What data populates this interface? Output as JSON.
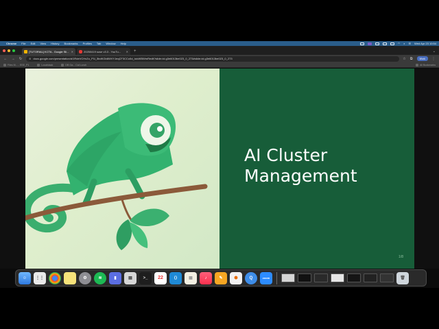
{
  "menubar": {
    "app_name": "Chrome",
    "items": [
      "File",
      "Edit",
      "View",
      "History",
      "Bookmarks",
      "Profiles",
      "Tab",
      "Window",
      "Help"
    ],
    "clock": "Wed Apr 23 10:54"
  },
  "tabs": [
    {
      "title": "[TUTORIAL] KCTA - Google Sli...",
      "favicon_color": "#f4b400",
      "active": true
    },
    {
      "title": "20250419 suse v3.3 - YouTu...",
      "favicon_color": "#e53935",
      "active": false
    }
  ],
  "address_bar": {
    "url": "docs.google.com/presentation/d/1RdeVCHvZo_P1l_5bdKGb8WVYJeqCF3CCo5d_lcicWBWmRedit?slide=id.g3e6013be023_0_273#slide=id.g3e6013be023_0_273",
    "profile_label": "Work"
  },
  "bookmarks": {
    "items": [
      "Files M... - SSE_P1",
      "Localstack",
      "DB Ga... Cal Lunch"
    ],
    "all_bookmarks": "All Bookmarks"
  },
  "slide": {
    "title_line1": "AI Cluster",
    "title_line2": "Management",
    "slide_number": "1/8"
  },
  "dock": {
    "calendar_day": "22"
  },
  "colors": {
    "slide_right_bg": "#175d39",
    "chameleon_green": "#30ba78",
    "branch_brown": "#8b5a3a"
  }
}
